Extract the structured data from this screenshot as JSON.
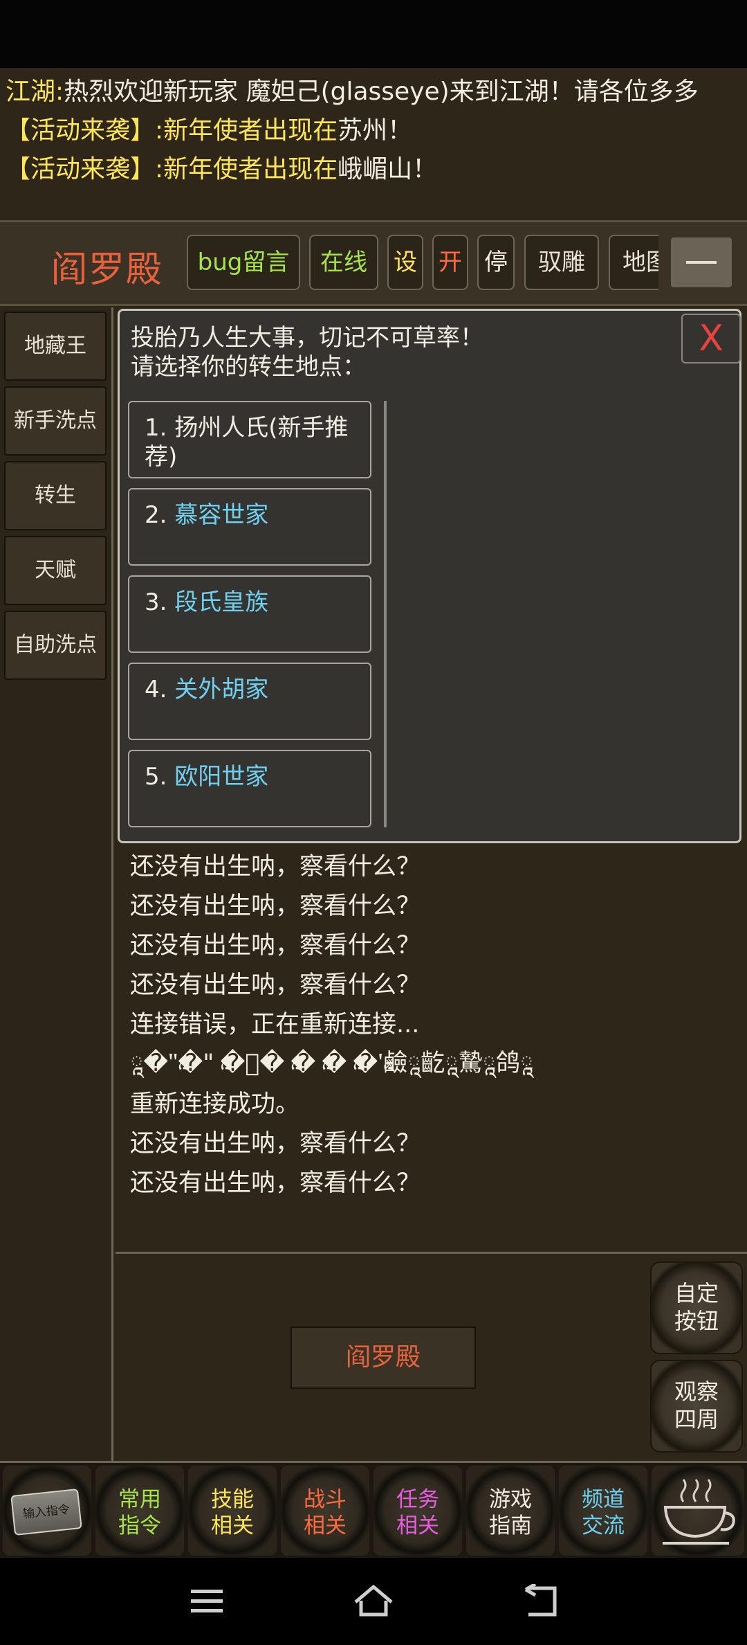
{
  "broadcast": {
    "line1_prefix": "江湖:",
    "line1_text": "热烈欢迎新玩家  魔妲己(glasseye)来到江湖！请各位多多",
    "line2_tag": "【活动来袭】:新年使者出现在",
    "line2_place": "苏州！",
    "line3_tag": "【活动来袭】:新年使者出现在",
    "line3_place": "峨嵋山！"
  },
  "header": {
    "location": "阎罗殿",
    "buttons": {
      "bug": "bug留言",
      "online": "在线",
      "settings": "设",
      "open": "开",
      "stop": "停",
      "tame": "驭雕",
      "map": "地图"
    }
  },
  "sidebar": {
    "items": [
      "地藏王",
      "新手洗点",
      "转生",
      "天赋",
      "自助洗点"
    ]
  },
  "dialog": {
    "line1": "投胎乃人生大事，切记不可草率！",
    "line2": "请选择你的转生地点：",
    "close": "X",
    "options": [
      {
        "num": "1. ",
        "label": "扬州人氏(新手推荐)"
      },
      {
        "num": "2. ",
        "label": "慕容世家"
      },
      {
        "num": "3. ",
        "label": "段氏皇族"
      },
      {
        "num": "4. ",
        "label": "关外胡家"
      },
      {
        "num": "5. ",
        "label": "欧阳世家"
      }
    ]
  },
  "log": {
    "messages": [
      "还没有出生呐，察看什么？",
      "还没有出生呐，察看什么？",
      "还没有出生呐，察看什么？",
      "还没有出生呐，察看什么？",
      "还没有出生呐，察看什么？",
      "连接错误，正在重新连接...",
      "ཱ�\"ཱ�\"      ཱ�ཱ�    ཱ�    ཱ�    ཱ�'ཱ鹼ཱ齕ཱ騺ཱ鸽ཱ",
      "重新连接成功。",
      "还没有出生呐，察看什么？",
      "还没有出生呐，察看什么？"
    ]
  },
  "main": {
    "place_button": "阎罗殿",
    "custom_button": [
      "自定",
      "按钮"
    ],
    "observe_button": [
      "观察",
      "四周"
    ]
  },
  "bottombar": {
    "input": "输入指令",
    "tabs": [
      {
        "line1": "常用",
        "line2": "指令"
      },
      {
        "line1": "技能",
        "line2": "相关"
      },
      {
        "line1": "战斗",
        "line2": "相关"
      },
      {
        "line1": "任务",
        "line2": "相关"
      },
      {
        "line1": "游戏",
        "line2": "指南"
      },
      {
        "line1": "频道",
        "line2": "交流"
      }
    ]
  },
  "colors": {
    "background": "#2e2719",
    "location_red": "#e8623e",
    "green": "#a6e44a",
    "yellow": "#ffe55a",
    "cyan": "#6fd0f0",
    "magenta": "#e85ce0"
  }
}
